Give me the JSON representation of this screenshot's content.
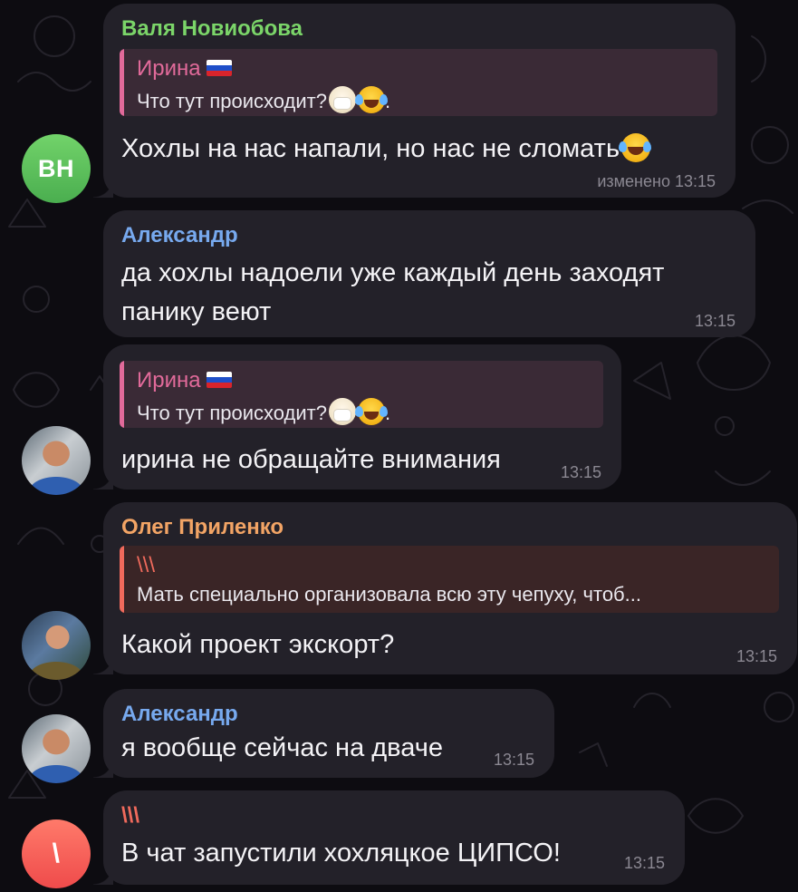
{
  "colors": {
    "bubble_bg": "#232129",
    "name_green": "#7bd569",
    "name_pink": "#e16a9a",
    "name_blue": "#77a9ee",
    "name_orange": "#f2a465",
    "name_red": "#f06a5c",
    "timestamp": "#8b8892"
  },
  "messages": [
    {
      "sender": "Валя Новиобова",
      "avatar_initials": "ВН",
      "reply": {
        "name": "Ирина",
        "text": "Что тут происходит?"
      },
      "text": "Хохлы на нас напали, но нас не сломать",
      "edited_time": "изменено 13:15"
    },
    {
      "sender": "Александр",
      "text_line1": "да хохлы надоели уже каждый день заходят",
      "text_line2": "панику веют",
      "time": "13:15"
    },
    {
      "avatar_name": "Александр",
      "reply": {
        "name": "Ирина",
        "text": "Что тут происходит?"
      },
      "text": "ирина не обращайте внимания",
      "time": "13:15"
    },
    {
      "sender": "Олег Приленко",
      "reply": {
        "name": "\\\\\\",
        "text": "Мать специально организовала всю эту чепуху, чтоб..."
      },
      "text": "Какой проект экскорт?",
      "time": "13:15"
    },
    {
      "sender": "Александр",
      "text": "я вообще сейчас на дваче",
      "time": "13:15"
    },
    {
      "sender": "\\\\\\",
      "avatar_initials": "\\",
      "text": "В чат запустили хохляцкое ЦИПСО!",
      "time": "13:15"
    }
  ]
}
